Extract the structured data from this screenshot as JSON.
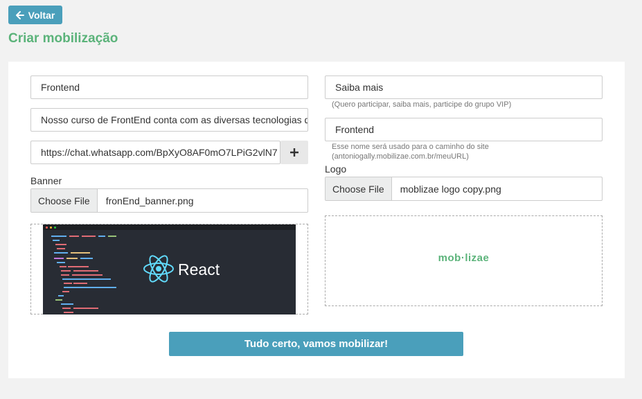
{
  "header": {
    "back_label": "Voltar",
    "title": "Criar mobilização"
  },
  "form": {
    "name_value": "Frontend",
    "description_value": "Nosso curso de FrontEnd conta com as diversas tecnologias d",
    "whatsapp_value": "https://chat.whatsapp.com/BpXyO8AF0mO7LPiG2vlN7",
    "add_icon": "plus-icon",
    "cta_value": "Saiba mais",
    "cta_help": "(Quero participar, saiba mais, participe do grupo VIP)",
    "slug_value": "Frontend",
    "slug_help_line1": "Esse nome será usado para o caminho do site",
    "slug_help_line2": "(antoniogally.mobilizae.com.br/meuURL)",
    "banner_label": "Banner",
    "banner_choose": "Choose File",
    "banner_file": "fronEnd_banner.png",
    "banner_preview_text": "React",
    "logo_label": "Logo",
    "logo_choose": "Choose File",
    "logo_file": "moblizae logo copy.png",
    "logo_preview_text": "mob·lizae",
    "submit_label": "Tudo certo, vamos mobilizar!"
  },
  "colors": {
    "accent": "#4a9fbb",
    "title_green": "#5bb37a",
    "react_blue": "#61dafb"
  }
}
